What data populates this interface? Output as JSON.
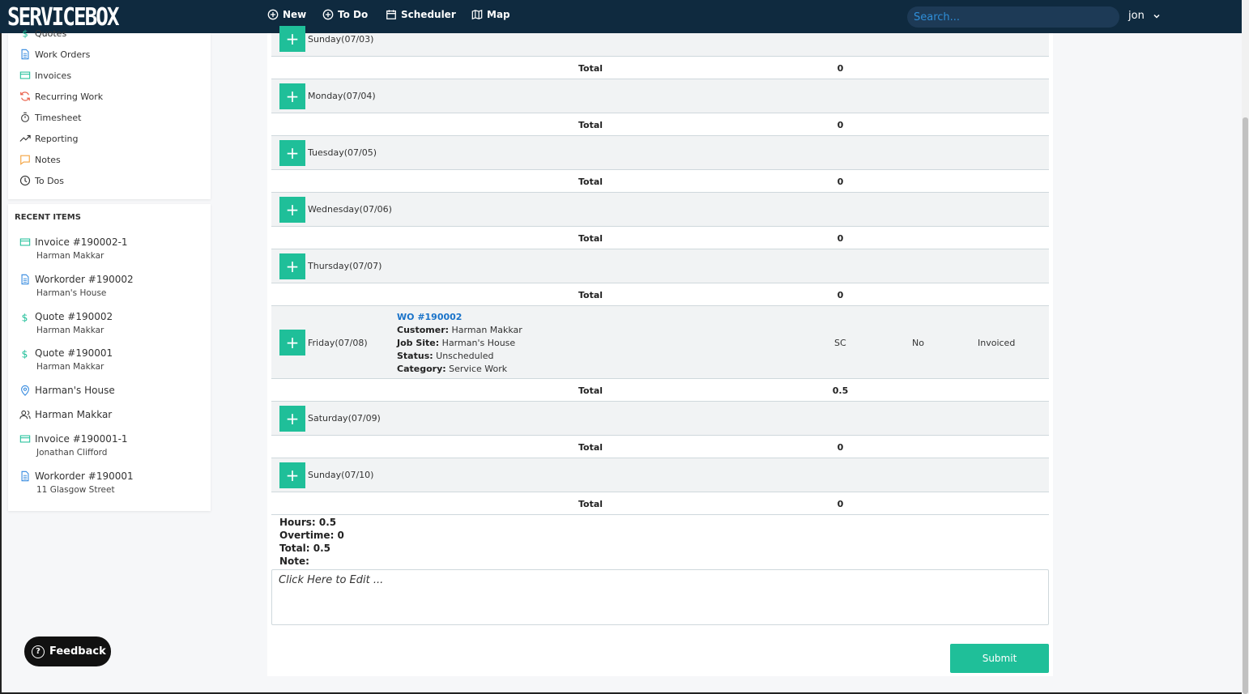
{
  "app": {
    "logo": "SERVICEBOX"
  },
  "nav": {
    "new": "New",
    "todo": "To Do",
    "scheduler": "Scheduler",
    "map": "Map",
    "search_placeholder": "Search...",
    "user": "jon"
  },
  "sidebar": {
    "menu": [
      {
        "label": "Quotes"
      },
      {
        "label": "Work Orders"
      },
      {
        "label": "Invoices"
      },
      {
        "label": "Recurring Work"
      },
      {
        "label": "Timesheet"
      },
      {
        "label": "Reporting"
      },
      {
        "label": "Notes"
      },
      {
        "label": "To Dos"
      }
    ],
    "recent_title": "RECENT ITEMS",
    "recent": [
      {
        "title": "Invoice #190002-1",
        "sub": "Harman Makkar"
      },
      {
        "title": "Workorder #190002",
        "sub": "Harman's House"
      },
      {
        "title": "Quote #190002",
        "sub": "Harman Makkar"
      },
      {
        "title": "Quote #190001",
        "sub": "Harman Makkar"
      },
      {
        "title": "Harman's House",
        "sub": ""
      },
      {
        "title": "Harman Makkar",
        "sub": ""
      },
      {
        "title": "Invoice #190001-1",
        "sub": "Jonathan Clifford"
      },
      {
        "title": "Workorder #190001",
        "sub": "11 Glasgow Street"
      }
    ],
    "feedback": "Feedback"
  },
  "timesheet": {
    "add_symbol": "+",
    "total_label": "Total",
    "days": [
      {
        "label": "Sunday(07/03)",
        "total": "0"
      },
      {
        "label": "Monday(07/04)",
        "total": "0"
      },
      {
        "label": "Tuesday(07/05)",
        "total": "0"
      },
      {
        "label": "Wednesday(07/06)",
        "total": "0"
      },
      {
        "label": "Thursday(07/07)",
        "total": "0"
      },
      {
        "label": "Friday(07/08)",
        "total": "0.5"
      },
      {
        "label": "Saturday(07/09)",
        "total": "0"
      },
      {
        "label": "Sunday(07/10)",
        "total": "0"
      }
    ],
    "entry": {
      "wo": "WO #190002",
      "customer_label": "Customer:",
      "customer": "Harman Makkar",
      "jobsite_label": "Job Site:",
      "jobsite": "Harman's House",
      "status_label": "Status:",
      "status": "Unscheduled",
      "category_label": "Category:",
      "category": "Service Work",
      "code": "SC",
      "overtime": "No",
      "billing": "Invoiced"
    },
    "summary": {
      "hours": "Hours: 0.5",
      "overtime": "Overtime: 0",
      "total": "Total: 0.5",
      "note": "Note:"
    },
    "note_placeholder": "Click Here to Edit ...",
    "submit": "Submit"
  }
}
